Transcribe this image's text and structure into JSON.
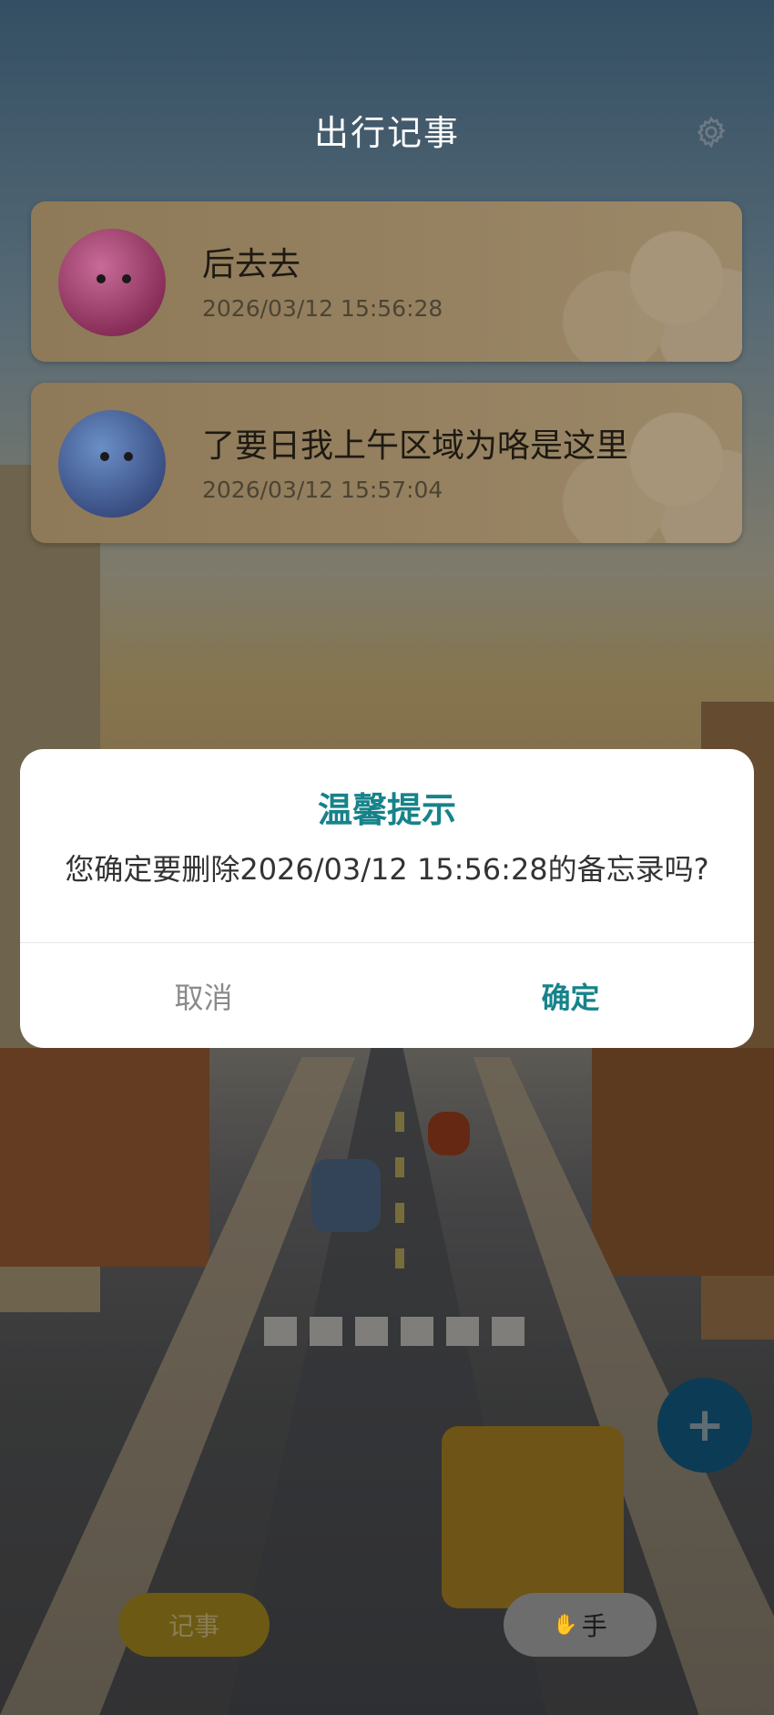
{
  "header": {
    "title": "出行记事"
  },
  "memos": [
    {
      "title": "后去去",
      "time": "2026/03/12 15:56:28"
    },
    {
      "title": "了要日我上午区域为咯是这里",
      "time": "2026/03/12 15:57:04"
    }
  ],
  "dialog": {
    "title": "温馨提示",
    "message": "您确定要删除2026/03/12 15:56:28的备忘录吗?",
    "cancel_label": "取消",
    "confirm_label": "确定"
  },
  "fab": {
    "label": "+"
  },
  "bottom_nav": {
    "memo_label": "记事",
    "assist_label": "手"
  },
  "colors": {
    "accent": "#16838a",
    "fab": "#0c5a85",
    "memo_button": "#c9a61c"
  }
}
